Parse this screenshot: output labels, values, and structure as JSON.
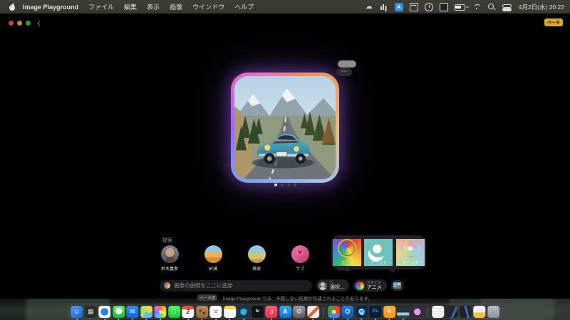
{
  "menu_bar": {
    "app_name": "Image Playground",
    "menus": [
      {
        "label": "ファイル"
      },
      {
        "label": "編集"
      },
      {
        "label": "表示"
      },
      {
        "label": "画像"
      },
      {
        "label": "ウインドウ"
      },
      {
        "label": "ヘルプ"
      }
    ],
    "status_icons": [
      {
        "type": "si-cloud",
        "name": "cloud-icon"
      },
      {
        "type": "si-graph",
        "name": "activity-graph-icon"
      },
      {
        "type": "si-lang",
        "name": "input-source-icon"
      },
      {
        "type": "si-window",
        "name": "window-manager-icon"
      },
      {
        "type": "si-clock",
        "name": "clock-status-icon"
      },
      {
        "type": "si-display",
        "name": "display-icon"
      },
      {
        "type": "si-battery",
        "name": "battery-icon"
      },
      {
        "type": "si-wifi",
        "name": "wifi-icon"
      },
      {
        "type": "si-search",
        "name": "spotlight-search-icon"
      },
      {
        "type": "si-cc",
        "name": "control-center-icon"
      }
    ],
    "clock": "4月2日(水) 20:22"
  },
  "window": {
    "beta_badge": "ベータ",
    "back_label": "‹",
    "more_label": "⋯",
    "carousel_dots": [
      {
        "active": true
      },
      {
        "active": false
      },
      {
        "active": false
      },
      {
        "active": false
      }
    ]
  },
  "suggestions": {
    "label": "提案",
    "items": [
      {
        "label": "鈴木義孝",
        "type": "person"
      },
      {
        "label": "砂漠",
        "type": "desert"
      },
      {
        "label": "草原",
        "type": "meadow"
      },
      {
        "label": "ラブ",
        "type": "love"
      },
      {
        "label": "初の雪",
        "type": "snow"
      }
    ]
  },
  "style_popup": {
    "options": [
      {
        "label": "アニメ",
        "selected": true,
        "bg": "conic-gradient(from 30deg,#e84040,#f0a030,#f0e040,#40b860,#3090e0,#8050c0,#e84040)"
      },
      {
        "label": "イラスト",
        "selected": false,
        "bg": "radial-gradient(circle at 42% 55%,#ffffff 34%,rgba(0,0,0,0) 36%),radial-gradient(circle at 62% 45%,#f0a040 18%,rgba(0,0,0,0) 20%),#6ec4bc"
      },
      {
        "label": "スケッチ",
        "selected": false,
        "bg": "radial-gradient(circle at 50% 52%,#ffffff 18%,rgba(0,0,0,0) 20%),conic-gradient(#e8a0a0,#a0c8e8,#a0e0b0,#f0d090,#e8a0a0)"
      }
    ]
  },
  "composer": {
    "placeholder": "画像の説明をここに追加",
    "person_chip": {
      "kicker": "人",
      "value": "選択..."
    },
    "style_chip": {
      "kicker": "スタイル",
      "value": "アニメ"
    }
  },
  "disclaimer": {
    "badge": "ベータ版",
    "text": "Image Playground では、予期しない結果が作成されることがあります。"
  },
  "dock": {
    "items": [
      {
        "name": "finder",
        "glyph": "☺",
        "running": true,
        "bg": "linear-gradient(135deg,#4f9cf0,#1a66c8)"
      },
      {
        "name": "launchpad",
        "glyph": "▦",
        "running": false,
        "bg": "#2b2b2d",
        "color": "#d8d8dc"
      },
      {
        "name": "safari",
        "glyph": "",
        "running": true,
        "bg": "radial-gradient(circle at 50% 50%,#1b88e8 42%,rgba(0,0,0,0) 44%),#f2f2f5"
      },
      {
        "name": "messages",
        "glyph": "",
        "running": true,
        "bg": "radial-gradient(circle at 50% 44%,#ffffff 36%,rgba(0,0,0,0) 38%),linear-gradient(#5df06a,#13bd2c)"
      },
      {
        "name": "mail",
        "glyph": "✉",
        "running": true,
        "bg": "linear-gradient(#2f8df2,#1465d8)"
      },
      {
        "name": "maps",
        "glyph": "",
        "running": true,
        "bg": "radial-gradient(circle at 70% 30%,#f6d33c 28%,rgba(0,0,0,0) 30%),linear-gradient(115deg,#9fe27a 45%,#68b8f0 45%)"
      },
      {
        "name": "photos",
        "glyph": "",
        "running": true,
        "bg": "radial-gradient(circle at 50% 50%,#fff 12%,rgba(0,0,0,0) 13%),conic-gradient(#ff5f5f,#ffb44c,#f8ef42,#7ed957,#4cc3ff,#7a6ff0,#e46bd8,#ff5f5f)"
      },
      {
        "name": "facetime",
        "glyph": "□",
        "running": false,
        "bg": "linear-gradient(#51f76b,#18c931)"
      },
      {
        "name": "calendar",
        "glyph": "2",
        "running": true,
        "bg": "linear-gradient(#ec4d3c 0 30%,#ffffff 30%)",
        "color": "#333"
      },
      {
        "name": "cork-board",
        "glyph": "",
        "running": true,
        "bg": "radial-gradient(circle at 35% 40%,#6a4a2a 12%,rgba(0,0,0,0) 14%),radial-gradient(circle at 65% 60%,#5a3a20 12%,rgba(0,0,0,0) 14%),linear-gradient(#b88a58,#96663a)"
      },
      {
        "name": "reminders",
        "glyph": "≡",
        "running": true,
        "bg": "#ffffff",
        "color": "#e8463c"
      },
      {
        "name": "notes",
        "glyph": "",
        "running": true,
        "bg": "linear-gradient(#f7d54c 0 28%,#ffffff 28%)"
      },
      {
        "name": "weather-circle-app",
        "glyph": "",
        "running": true,
        "bg": "radial-gradient(circle at 50% 50%,#2ab8c8 36%,rgba(0,0,0,0) 38%),radial-gradient(circle at 68% 38%,#e05050 10%,rgba(0,0,0,0) 12%),#12355e"
      },
      {
        "name": "apple-tv",
        "glyph": "tv",
        "running": false,
        "bg": "#111114"
      },
      {
        "name": "music",
        "glyph": "♫",
        "running": true,
        "bg": "linear-gradient(#fb5d7d,#f22b49)"
      },
      {
        "name": "app-store",
        "glyph": "A",
        "running": false,
        "bg": "linear-gradient(#2fa7f5,#1470e0)"
      },
      {
        "name": "system-settings",
        "glyph": "⚙",
        "running": false,
        "bg": "linear-gradient(#9a9aa0,#5a5a60)",
        "color": "#ededf0"
      },
      {
        "name": "image-playground",
        "glyph": "",
        "running": true,
        "bg": "linear-gradient(135deg,rgba(0,0,0,0) 42%,#e85d3a 42% 60%,rgba(0,0,0,0) 60%),#f3ece4"
      },
      {
        "name": "separator",
        "separator": true
      },
      {
        "name": "chrome",
        "glyph": "",
        "running": true,
        "bg": "radial-gradient(circle at 50% 50%,#ffffff 14%,#fbbc05 15% 26%,rgba(0,0,0,0) 27%),conic-gradient(#ea4335 0 33%,#4285f4 33% 66%,#34a853 66%)"
      },
      {
        "name": "outlook",
        "glyph": "O",
        "running": true,
        "bg": "linear-gradient(#1e7be0,#0a56b0)"
      },
      {
        "name": "quicktime",
        "glyph": "Q",
        "running": true,
        "bg": "radial-gradient(circle at 50% 50%,#1e90ff 38%,#0b2a4a 40%)"
      },
      {
        "name": "photoshop",
        "glyph": "Ps",
        "running": true,
        "bg": "#001e36",
        "ps": true
      },
      {
        "name": "pages",
        "glyph": "✎",
        "running": true,
        "bg": "linear-gradient(#ffb23e,#f7931e)"
      },
      {
        "name": "media-dark-app",
        "glyph": "",
        "running": true,
        "bg": "linear-gradient(#2b2f36 55%,#9ecbe8 55% 80%,#3a3f46 80%)"
      },
      {
        "name": "purple-circle-app",
        "glyph": "",
        "running": false,
        "bg": "radial-gradient(circle at 50% 50%,#d9a0e8 38%,#3a2a44 40%)"
      },
      {
        "name": "separator",
        "separator": true
      },
      {
        "name": "document-file",
        "glyph": "",
        "running": false,
        "bg": "repeating-linear-gradient(#f7f7f7 0 3px,#d8d8d8 3px 4px)"
      },
      {
        "name": "minimized-window",
        "glyph": "",
        "running": false,
        "bg": "linear-gradient(115deg,#222630 60%,#3a66a8 60% 75%,#1a1d24 75%)"
      },
      {
        "name": "minimized-window",
        "glyph": "",
        "running": false,
        "bg": "linear-gradient(75deg,#1d2026 50%,#3a78c8 50% 62%,#23262e 62%)"
      },
      {
        "name": "downloads-folder",
        "glyph": "",
        "running": false,
        "bg": "linear-gradient(180deg,#f0f0f0 55%,#f0c048 55%)"
      },
      {
        "name": "trash",
        "glyph": "",
        "running": false,
        "trash": true
      }
    ]
  }
}
